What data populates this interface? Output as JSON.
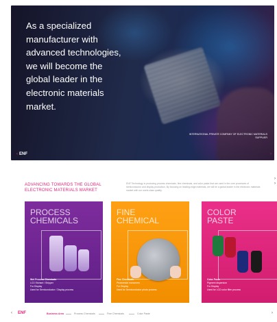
{
  "hero": {
    "headline": "As a specialized manufacturer with advanced technologies, we will become the global leader in the electronic materials market.",
    "caption": "INTERNATIONAL PRIVATE COMPANY OF ELECTRONIC MATERIALS SUPPLIER",
    "logo": "ENF",
    "next": "›"
  },
  "page2": {
    "headline": "ADVANCING TOWARDS THE GLOBAL ELECTRONIC MATERIALS MARKET",
    "intro": "ENF Technology is producing process chemicals, fine chemicals, and color paste that are used in the core processes of semiconductor and display production. By focusing on leading-edge materials, we will be a global leader in the electronic materials market with our world-class quality.",
    "cards": [
      {
        "title_line1": "PROCESS",
        "title_line2": "CHEMICALS",
        "info_title": "Wet Process Chemicals",
        "info_line1": "LCD Etchant / Stripper",
        "info_line2": "For Display",
        "info_line3": "Used for Semiconductor / Display process"
      },
      {
        "title_line1": "FINE",
        "title_line2": "CHEMICAL",
        "info_title": "Fine Chemicals",
        "info_line1": "Photoresist monomers",
        "info_line2": "For Display",
        "info_line3": "Used for Semiconductor photo process"
      },
      {
        "title_line1": "COLOR",
        "title_line2": "PASTE",
        "info_title": "Color Paste",
        "info_line1": "Pigment dispersion",
        "info_line2": "For Display",
        "info_line3": "Used for LCD color filter process"
      }
    ]
  },
  "footer": {
    "brand": "ENF",
    "nav": [
      "Business Area",
      "Process Chemicals",
      "Fine Chemicals",
      "Color Paste"
    ]
  },
  "colors": {
    "accent": "#e2247a",
    "purple": "#7e2c9d",
    "orange": "#f18e00",
    "pink": "#d11d6f"
  }
}
